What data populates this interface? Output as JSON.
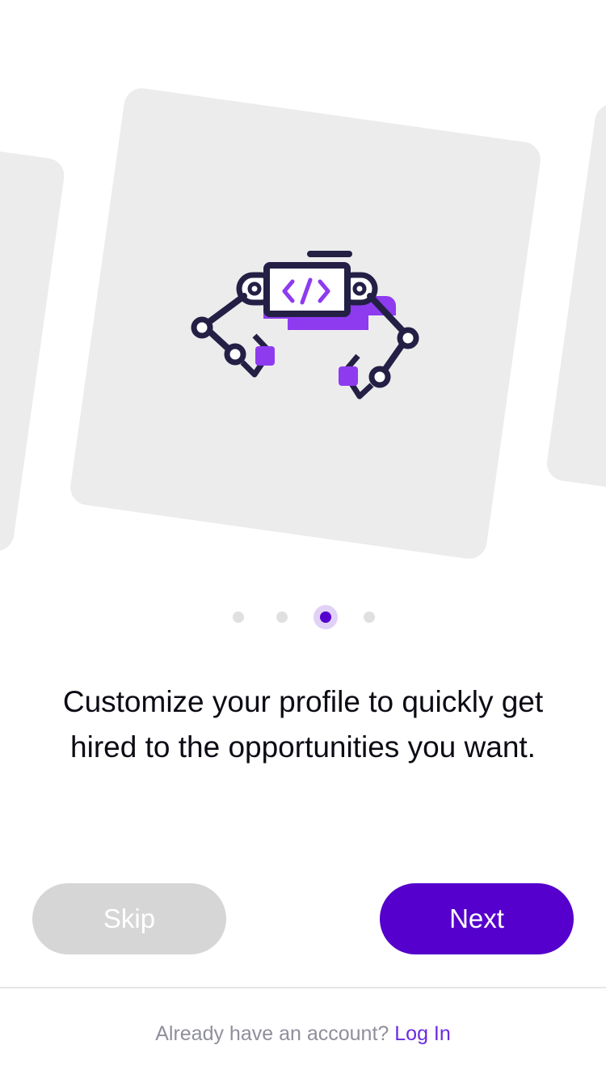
{
  "carousel": {
    "illustration_icon": "robot-arms-code-icon",
    "page_count": 4,
    "active_page": 3
  },
  "onboarding": {
    "message_line1": "Customize your profile to quickly get",
    "message_line2": "hired to the opportunities you want."
  },
  "actions": {
    "skip_label": "Skip",
    "next_label": "Next"
  },
  "footer": {
    "prompt": "Already have an account?",
    "login_label": "Log In"
  },
  "colors": {
    "accent": "#5500cc",
    "accent_light": "#8e3bf0",
    "illustration_dark": "#231f45",
    "card": "#ececec",
    "skip_button": "#d6d6d6"
  }
}
